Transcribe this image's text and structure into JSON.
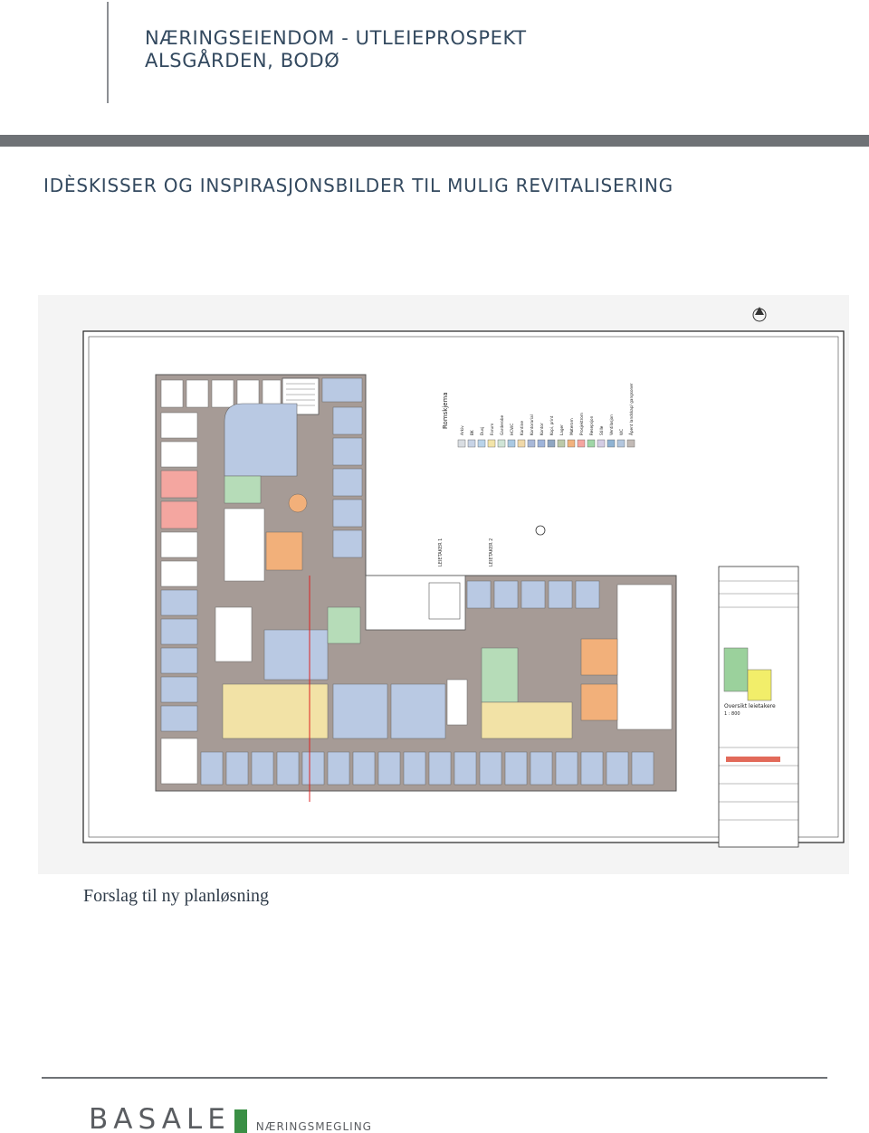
{
  "header": {
    "title_line1": "NÆRINGSEIENDOM - UTLEIEPROSPEKT",
    "title_line2": "ALSGÅRDEN, BODØ"
  },
  "section": {
    "title": "IDÈSKISSER OG INSPIRASJONSBILDER TIL MULIG REVITALISERING"
  },
  "floorplan": {
    "legend_title": "Romskjema",
    "legend_items": [
      {
        "label": "Arkiv",
        "color": "#d9dde2"
      },
      {
        "label": "BK",
        "color": "#c7d3e6"
      },
      {
        "label": "Dusj",
        "color": "#b9d3ea"
      },
      {
        "label": "Forum",
        "color": "#f3e4a8"
      },
      {
        "label": "Garderobe",
        "color": "#cfe4d6"
      },
      {
        "label": "HCWC",
        "color": "#a9c8e2"
      },
      {
        "label": "Kantine",
        "color": "#f0d8a8"
      },
      {
        "label": "Kontorarial",
        "color": "#a8b8d8"
      },
      {
        "label": "Kontor",
        "color": "#9eb4da"
      },
      {
        "label": "Kopi, print",
        "color": "#8fa6c2"
      },
      {
        "label": "Lager",
        "color": "#bcc9a8"
      },
      {
        "label": "Møterom",
        "color": "#f2b27d"
      },
      {
        "label": "Prosjektrom",
        "color": "#f5a5a0"
      },
      {
        "label": "Resepsjon",
        "color": "#9fd6a6"
      },
      {
        "label": "Stille",
        "color": "#d3cce4"
      },
      {
        "label": "Ventilasjon",
        "color": "#8fb3d3"
      },
      {
        "label": "WC",
        "color": "#b3c6de"
      },
      {
        "label": "Åpent landskap/ gangsoner",
        "color": "#c2bab6"
      }
    ],
    "tenant1": "LEIETAKER 1",
    "tenant2": "LEIETAKER 2",
    "overview_label": "Oversikt leietakere",
    "overview_scale": "1 : 800",
    "colors": {
      "wall": "#a69b96",
      "office": "#b9c9e3",
      "meeting": "#f2b07a",
      "forum": "#f2e2a6",
      "reception": "#b6dcb8",
      "project": "#f4a6a0",
      "core": "#ffffff",
      "tenant1_box": "#9bd19c",
      "tenant2_box": "#f2ee6a"
    }
  },
  "caption": "Forslag til ny planløsning",
  "footer": {
    "logo_text": "BASALE",
    "logo_sub": "NÆRINGSMEGLING",
    "logo_color": "#3a8f45"
  }
}
